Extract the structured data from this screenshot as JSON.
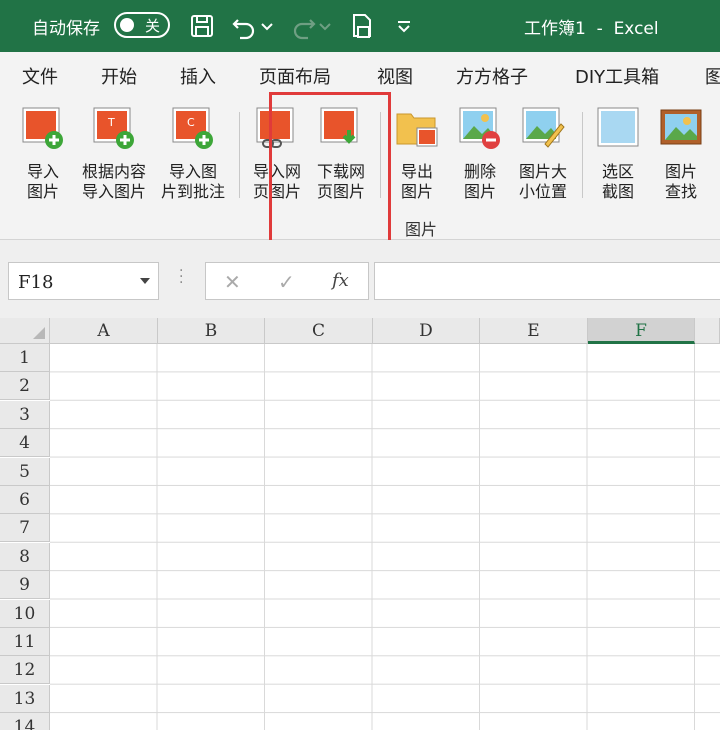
{
  "titlebar": {
    "autosave_label": "自动保存",
    "autosave_state": "关",
    "doc_title": "工作簿1  -  Excel",
    "icons": [
      "save-icon",
      "undo-icon",
      "redo-icon",
      "print-preview-icon",
      "customize-dropdown-icon"
    ]
  },
  "menu": {
    "tabs": [
      "文件",
      "开始",
      "插入",
      "页面布局",
      "视图",
      "方方格子",
      "DIY工具箱",
      "图"
    ]
  },
  "ribbon": {
    "buttons": [
      {
        "label": "导入\n图片",
        "icon": "import-picture-icon"
      },
      {
        "label": "根据内容\n导入图片",
        "icon": "import-by-content-icon"
      },
      {
        "label": "导入图\n片到批注",
        "icon": "import-to-comment-icon"
      },
      {
        "label": "导入网\n页图片",
        "icon": "import-web-picture-icon"
      },
      {
        "label": "下载网\n页图片",
        "icon": "download-web-picture-icon"
      },
      {
        "label": "导出\n图片",
        "icon": "export-picture-icon"
      },
      {
        "label": "删除\n图片",
        "icon": "delete-picture-icon"
      },
      {
        "label": "图片大\n小位置",
        "icon": "picture-size-position-icon"
      },
      {
        "label": "选区\n截图",
        "icon": "selection-screenshot-icon"
      },
      {
        "label": "图片\n查找",
        "icon": "find-picture-icon"
      }
    ],
    "group_label": "图片"
  },
  "formula_bar": {
    "name_box": "F18",
    "cancel_symbol": "✕",
    "confirm_symbol": "✓",
    "fx_label": "fx",
    "formula_value": ""
  },
  "sheet": {
    "columns": [
      "A",
      "B",
      "C",
      "D",
      "E",
      "F"
    ],
    "active_column": "F",
    "rows": [
      "1",
      "2",
      "3",
      "4",
      "5",
      "6",
      "7",
      "8",
      "9",
      "10",
      "11",
      "12",
      "13",
      "14"
    ]
  },
  "colors": {
    "excel_green": "#217346",
    "highlight_red": "#e03a3a"
  }
}
